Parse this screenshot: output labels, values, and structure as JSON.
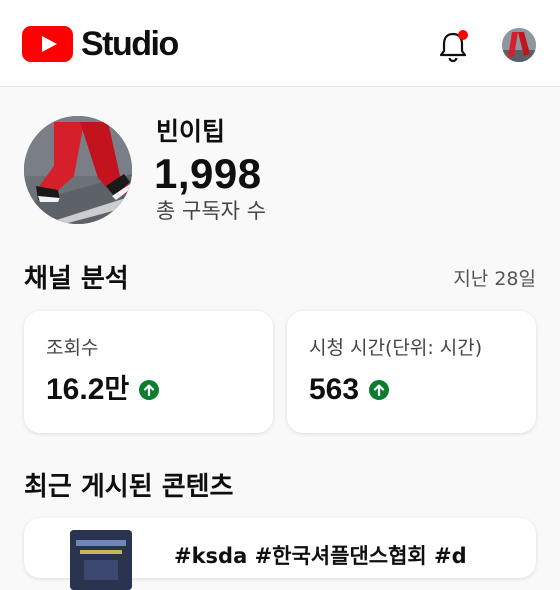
{
  "app": {
    "logo_text": "Studio"
  },
  "channel": {
    "name": "빈이팁",
    "subscriber_count": "1,998",
    "subscriber_label": "총 구독자 수"
  },
  "analytics": {
    "title": "채널 분석",
    "period": "지난 28일",
    "cards": [
      {
        "label": "조회수",
        "value": "16.2",
        "value_suffix": "만",
        "trend": "up"
      },
      {
        "label": "시청 시간(단위: 시간)",
        "value": "563",
        "value_suffix": "",
        "trend": "up"
      }
    ]
  },
  "recent": {
    "title": "최근 게시된 콘텐츠",
    "items": [
      {
        "title": "#ksda #한국셔플댄스협회 #d"
      }
    ]
  },
  "colors": {
    "brand_red": "#ff0000",
    "trend_up": "#0b7d2e",
    "background": "#f9f9f9"
  },
  "icons": {
    "notifications": "bell-icon",
    "trend": "arrow-up-circle-icon"
  }
}
